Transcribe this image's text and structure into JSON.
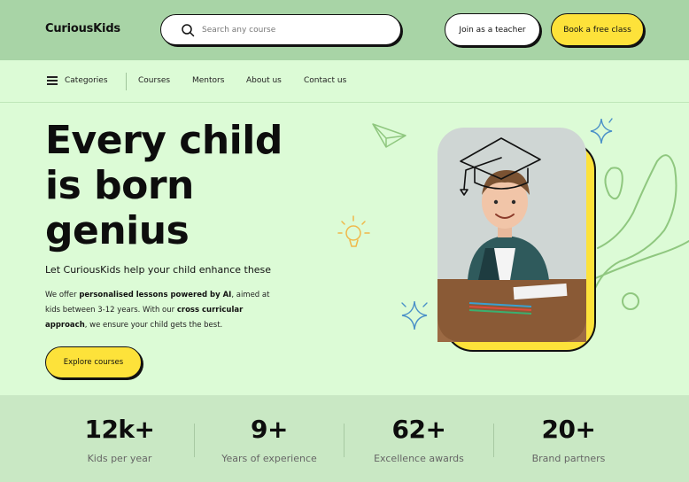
{
  "header": {
    "logo": "CuriousKids",
    "search_placeholder": "Search any course",
    "join_teacher": "Join as a teacher",
    "book_class": "Book a free class"
  },
  "nav": {
    "categories": "Categories",
    "items": [
      "Courses",
      "Mentors",
      "About us",
      "Contact us"
    ]
  },
  "hero": {
    "title_lines": [
      "Every child",
      "is born",
      "genius"
    ],
    "subtitle": "Let CuriousKids help your child enhance these",
    "desc_1": "We offer ",
    "desc_bold_1": "personalised lessons powered by AI",
    "desc_2": ", aimed at kids between 3-12 years. With our ",
    "desc_bold_2": "cross curricular approach",
    "desc_3": ", we ensure your child gets the best.",
    "cta": "Explore courses"
  },
  "stats": [
    {
      "value": "12k+",
      "label": "Kids per year"
    },
    {
      "value": "9+",
      "label": "Years of experience"
    },
    {
      "value": "62+",
      "label": "Excellence awards"
    },
    {
      "value": "20+",
      "label": "Brand partners"
    }
  ],
  "colors": {
    "header_bg": "#a8d4a6",
    "page_bg": "#dcfbd6",
    "accent_yellow": "#fde23a",
    "stats_bg": "#c9e8c4",
    "doodle_green": "#8fc77f",
    "doodle_blue": "#4a90c8",
    "doodle_orange": "#f0b84a"
  }
}
